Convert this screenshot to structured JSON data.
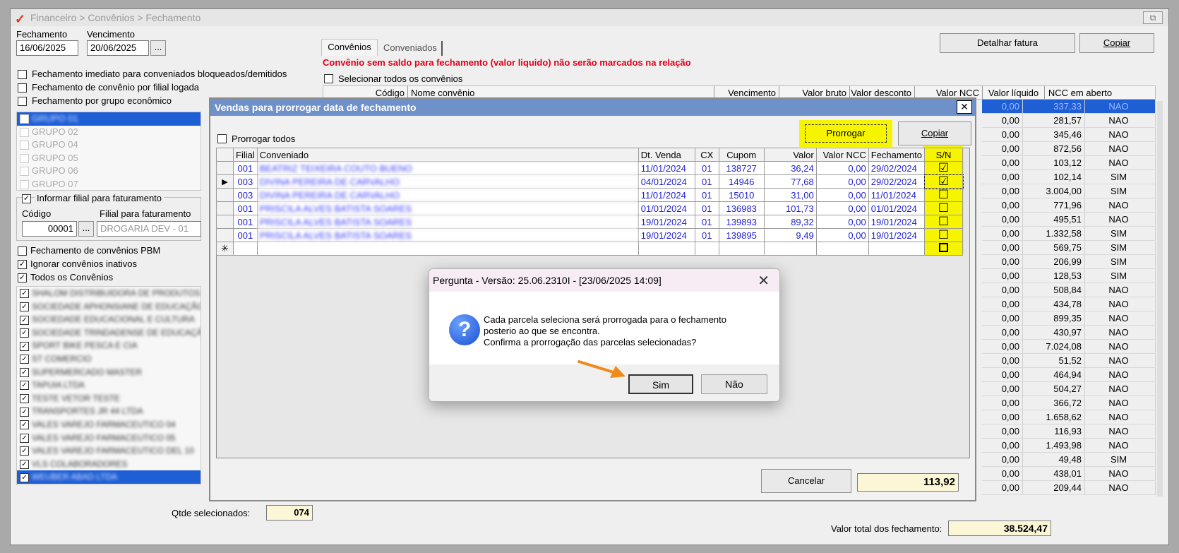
{
  "window": {
    "title": "Financeiro > Convênios > Fechamento",
    "restore_glyph": "⧉"
  },
  "left": {
    "fechamento_label": "Fechamento",
    "fechamento_value": "16/06/2025",
    "vencimento_label": "Vencimento",
    "vencimento_value": "20/06/2025",
    "ellipsis": "...",
    "opt1": "Fechamento imediato para conveniados bloqueados/demitidos",
    "opt2": "Fechamento de convênio por filial logada",
    "opt3": "Fechamento por grupo econômico",
    "groups": [
      "GRUPO 01",
      "GRUPO 02",
      "GRUPO 04",
      "GRUPO 05",
      "GRUPO 06",
      "GRUPO 07"
    ],
    "filial_group": "Informar filial para faturamento",
    "codigo_label": "Código",
    "codigo_value": "00001",
    "filial_fat_label": "Filial para faturamento",
    "filial_fat_value": "DROGARIA DEV - 01",
    "pbm": "Fechamento de convênios PBM",
    "ignorar": "Ignorar convênios inativos",
    "todos": "Todos os Convênios",
    "convenios": [
      "SHALOM DISTRIBUIDORA DE PRODUTOS",
      "SOCIEDADE APHONSIANE DE EDUCAÇÃO",
      "SOCIEDADE EDUCACIONAL E CULTURA",
      "SOCIEDADE TRINDADENSE DE EDUCAÇÃO",
      "SPORT BIKE PESCA E CIA",
      "ST COMERCIO",
      "SUPERMERCADO MASTER",
      "TAPUIA LTDA",
      "TESTE VETOR TESTE",
      "TRANSPORTES JR 44 LTDA",
      "VALES VAREJO FARMACEUTICO 04",
      "VALES VAREJO FARMACEUTICO 05",
      "VALES VAREJO FARMACEUTICO DEL 10",
      "VLS COLABORADORES",
      "WEUBER ABAD LTDA"
    ],
    "qtde_label": "Qtde selecionados:",
    "qtde_value": "074"
  },
  "right": {
    "tab1": "Convênios",
    "tab2": "Conveniados",
    "warning": "Convênio sem saldo para fechamento (valor liquido) não serão marcados na relação",
    "selecionar_todos": "Selecionar todos os convênios",
    "detalhar": "Detalhar fatura",
    "copiar": "Copiar",
    "headers": [
      "Código",
      "Nome convênio",
      "Vencimento",
      "Valor bruto",
      "Valor desconto",
      "Valor NCC",
      "Valor líquido",
      "NCC em aberto"
    ],
    "rows": [
      [
        "0,00",
        "337,33",
        "NAO"
      ],
      [
        "0,00",
        "281,57",
        "NAO"
      ],
      [
        "0,00",
        "345,46",
        "NAO"
      ],
      [
        "0,00",
        "872,56",
        "NAO"
      ],
      [
        "0,00",
        "103,12",
        "NAO"
      ],
      [
        "0,00",
        "102,14",
        "SIM"
      ],
      [
        "0,00",
        "3.004,00",
        "SIM"
      ],
      [
        "0,00",
        "771,96",
        "NAO"
      ],
      [
        "0,00",
        "495,51",
        "NAO"
      ],
      [
        "0,00",
        "1.332,58",
        "SIM"
      ],
      [
        "0,00",
        "569,75",
        "SIM"
      ],
      [
        "0,00",
        "206,99",
        "SIM"
      ],
      [
        "0,00",
        "128,53",
        "SIM"
      ],
      [
        "0,00",
        "508,84",
        "NAO"
      ],
      [
        "0,00",
        "434,78",
        "NAO"
      ],
      [
        "0,00",
        "899,35",
        "NAO"
      ],
      [
        "0,00",
        "430,97",
        "NAO"
      ],
      [
        "0,00",
        "7.024,08",
        "NAO"
      ],
      [
        "0,00",
        "51,52",
        "NAO"
      ],
      [
        "0,00",
        "464,94",
        "NAO"
      ],
      [
        "0,00",
        "504,27",
        "NAO"
      ],
      [
        "0,00",
        "366,72",
        "NAO"
      ],
      [
        "0,00",
        "1.658,62",
        "NAO"
      ],
      [
        "0,00",
        "116,93",
        "NAO"
      ],
      [
        "0,00",
        "1.493,98",
        "NAO"
      ],
      [
        "0,00",
        "49,48",
        "SIM"
      ],
      [
        "0,00",
        "438,01",
        "NAO"
      ],
      [
        "0,00",
        "209,44",
        "NAO"
      ]
    ],
    "total_label": "Valor total dos fechamento:",
    "total_value": "38.524,47"
  },
  "vendas": {
    "title": "Vendas para prorrogar data de fechamento",
    "prorrogar_todos": "Prorrogar todos",
    "prorrogar": "Prorrogar",
    "copiar": "Copiar",
    "headers": [
      "Filial",
      "Conveniado",
      "Dt. Venda",
      "CX",
      "Cupom",
      "Valor",
      "Valor NCC",
      "Fechamento",
      "S/N"
    ],
    "rows": [
      {
        "filial": "001",
        "nome": "BEATRIZ TEIXEIRA COUTO BUENO",
        "dt": "11/01/2024",
        "cx": "01",
        "cupom": "138727",
        "valor": "36,24",
        "ncc": "0,00",
        "fech": "29/02/2024",
        "sn": "☑"
      },
      {
        "filial": "003",
        "nome": "DIVINA PEREIRA DE CARVALHO",
        "dt": "04/01/2024",
        "cx": "01",
        "cupom": "14946",
        "valor": "77,68",
        "ncc": "0,00",
        "fech": "29/02/2024",
        "sn": "☑"
      },
      {
        "filial": "003",
        "nome": "DIVINA PEREIRA DE CARVALHO",
        "dt": "11/01/2024",
        "cx": "01",
        "cupom": "15010",
        "valor": "31,00",
        "ncc": "0,00",
        "fech": "11/01/2024",
        "sn": "☐"
      },
      {
        "filial": "001",
        "nome": "PRISCILA ALVES BATISTA SOARES",
        "dt": "01/01/2024",
        "cx": "01",
        "cupom": "136983",
        "valor": "101,73",
        "ncc": "0,00",
        "fech": "01/01/2024",
        "sn": "☐"
      },
      {
        "filial": "001",
        "nome": "PRISCILA ALVES BATISTA SOARES",
        "dt": "19/01/2024",
        "cx": "01",
        "cupom": "139893",
        "valor": "89,32",
        "ncc": "0,00",
        "fech": "19/01/2024",
        "sn": "☐"
      },
      {
        "filial": "001",
        "nome": "PRISCILA ALVES BATISTA SOARES",
        "dt": "19/01/2024",
        "cx": "01",
        "cupom": "139895",
        "valor": "9,49",
        "ncc": "0,00",
        "fech": "19/01/2024",
        "sn": "☐"
      }
    ],
    "new_row_marker": "✳",
    "current_marker": "▶",
    "cancelar": "Cancelar",
    "sum_value": "113,92"
  },
  "pergunta": {
    "title": "Pergunta - Versão: 25.06.2310I - [23/06/2025 14:09]",
    "close": "✕",
    "icon": "?",
    "line1": "Cada parcela seleciona será prorrogada para o fechamento",
    "line2": "posterio ao que se encontra.",
    "line3": "Confirma a prorrogação das parcelas selecionadas?",
    "sim": "Sim",
    "nao": "Não"
  },
  "colors": {
    "accent": "#f7f400",
    "arrow": "#f28a1a",
    "link_blue": "#1f1fd6",
    "title_blue": "#6f91c9"
  }
}
